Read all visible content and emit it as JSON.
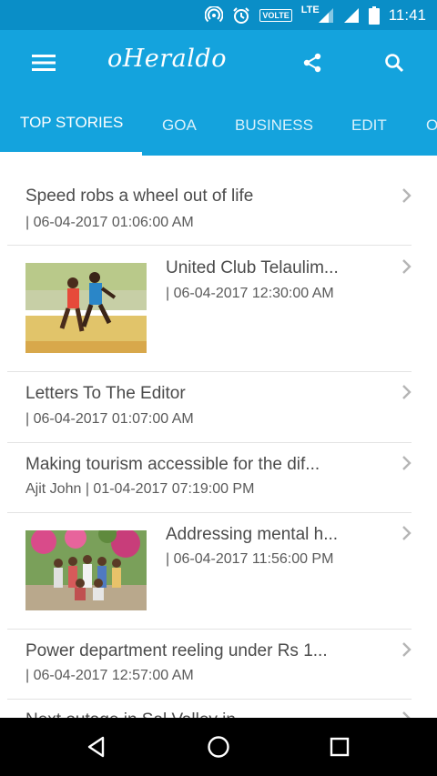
{
  "status": {
    "volte": "VOLTE",
    "network": "LTE",
    "time": "11:41"
  },
  "appbar": {
    "menu_icon": "menu-icon",
    "logo": "oHeraldo",
    "share_icon": "share-icon",
    "search_icon": "search-icon"
  },
  "tabs": [
    "TOP STORIES",
    "GOA",
    "BUSINESS",
    "EDIT",
    "O"
  ],
  "stories": [
    {
      "title": "Speed robs a wheel out of life",
      "meta": "| 06-04-2017 01:06:00 AM"
    },
    {
      "title": "United Club Telaulim...",
      "meta": "| 06-04-2017 12:30:00 AM"
    },
    {
      "title": "Letters To The Editor",
      "meta": "| 06-04-2017 01:07:00 AM"
    },
    {
      "title": "Making tourism accessible for the dif...",
      "meta": "Ajit John | 01-04-2017 07:19:00 PM"
    },
    {
      "title": "Addressing mental h...",
      "meta": "| 06-04-2017 11:56:00 PM"
    },
    {
      "title": "Power department reeling under Rs 1...",
      "meta": "| 06-04-2017 12:57:00 AM"
    },
    {
      "title": "Next outage in Sal Valley in... ",
      "meta": ""
    }
  ],
  "colors": {
    "primary": "#14a3dd",
    "statusbar": "#0a8ec7",
    "text": "#4b4b4b"
  }
}
